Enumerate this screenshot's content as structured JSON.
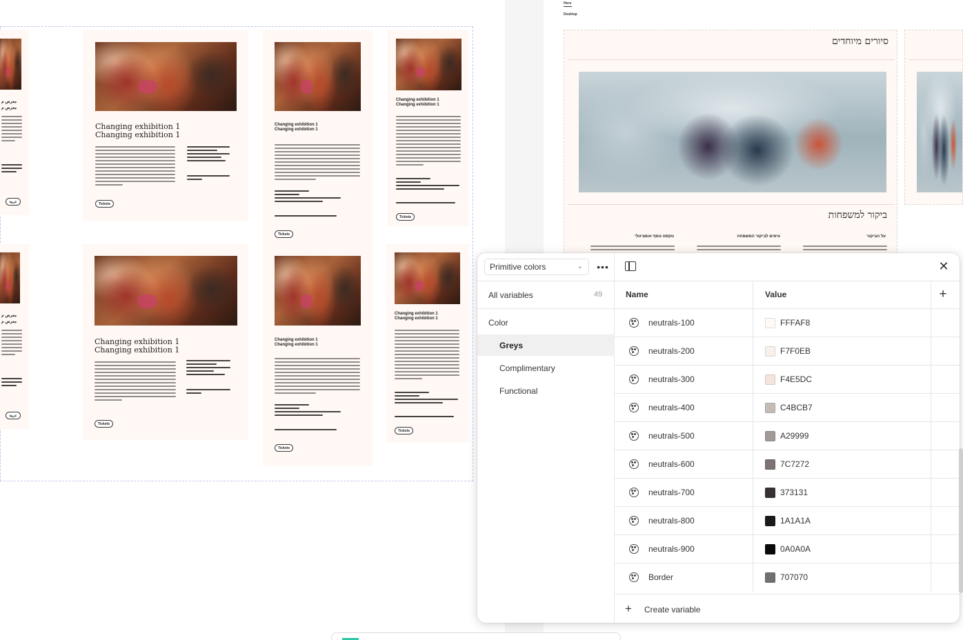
{
  "canvas": {
    "card_title_line1": "Changing exhibition 1",
    "card_title_line2": "Changing exhibition 1",
    "tickets_label": "Tickets",
    "hero_frame": {
      "label_hero": "Hero",
      "label_desktop": "Desktop",
      "heading_tours": "סיורים מיוחדים",
      "heading_family": "ביקור למשפחות",
      "col1_title": "על הביקור",
      "col2_title": "טיפים לביקור המשפחה",
      "col3_title": "טקסט נוסף אופציונלי"
    },
    "arabic_badge": "عربية"
  },
  "variables_panel": {
    "collection": "Primitive colors",
    "all_variables_label": "All variables",
    "all_variables_count": "49",
    "group_heading": "Color",
    "groups": [
      {
        "label": "Greys",
        "selected": true
      },
      {
        "label": "Complimentary",
        "selected": false
      },
      {
        "label": "Functional",
        "selected": false
      }
    ],
    "columns": {
      "name": "Name",
      "value": "Value"
    },
    "rows": [
      {
        "name": "neutrals-100",
        "hex": "FFFAF8",
        "color": "#FFFAF8"
      },
      {
        "name": "neutrals-200",
        "hex": "F7F0EB",
        "color": "#F7F0EB"
      },
      {
        "name": "neutrals-300",
        "hex": "F4E5DC",
        "color": "#F4E5DC"
      },
      {
        "name": "neutrals-400",
        "hex": "C4BCB7",
        "color": "#C4BCB7"
      },
      {
        "name": "neutrals-500",
        "hex": "A29999",
        "color": "#A29999"
      },
      {
        "name": "neutrals-600",
        "hex": "7C7272",
        "color": "#7C7272"
      },
      {
        "name": "neutrals-700",
        "hex": "373131",
        "color": "#373131"
      },
      {
        "name": "neutrals-800",
        "hex": "1A1A1A",
        "color": "#1A1A1A"
      },
      {
        "name": "neutrals-900",
        "hex": "0A0A0A",
        "color": "#0A0A0A"
      },
      {
        "name": "Border",
        "hex": "707070",
        "color": "#707070"
      }
    ],
    "create_label": "Create variable"
  }
}
